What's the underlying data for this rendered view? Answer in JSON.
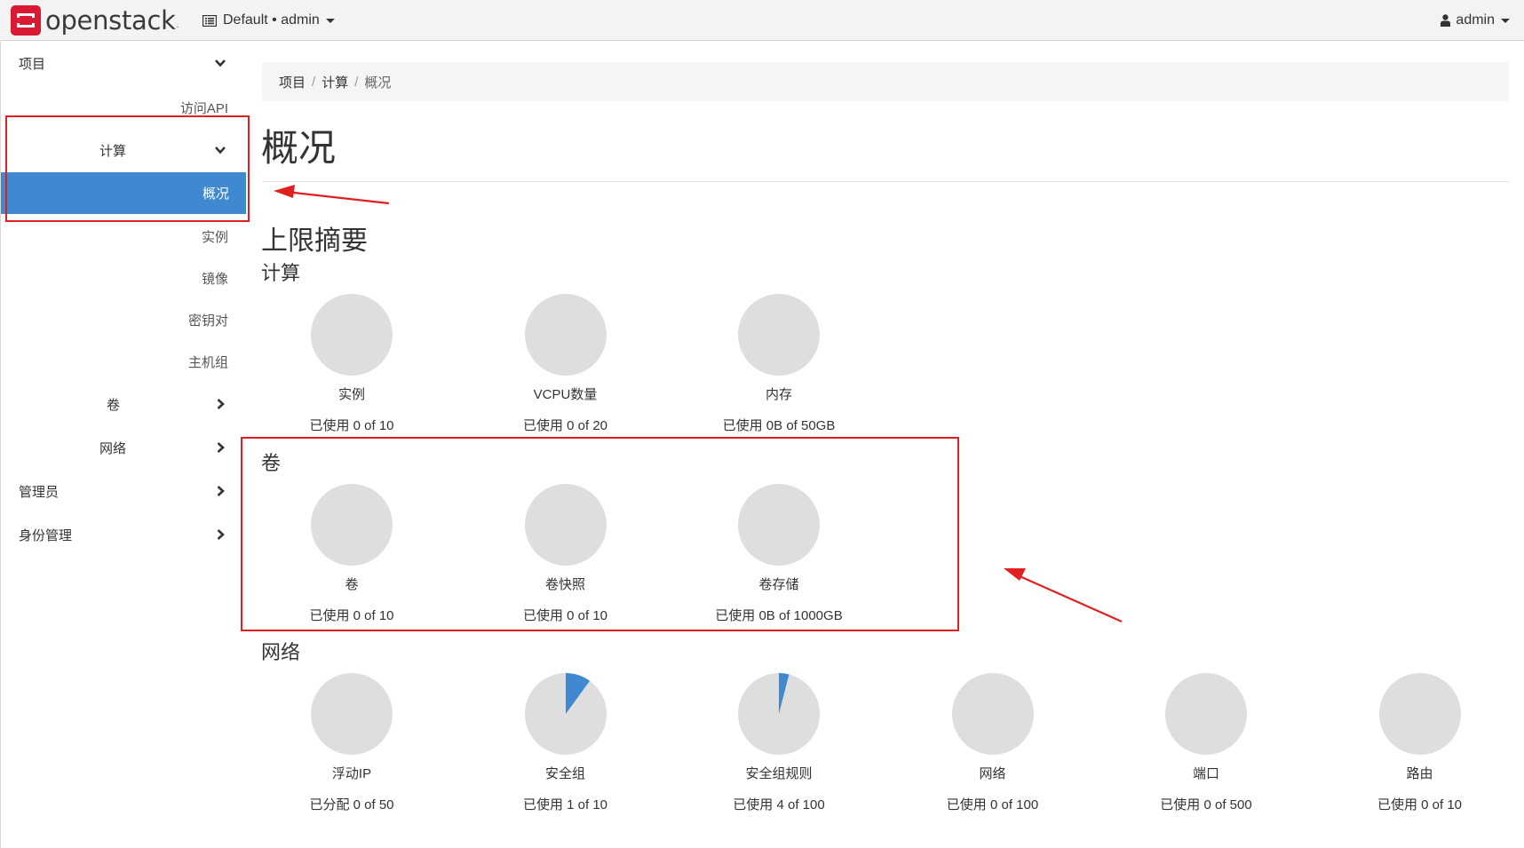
{
  "navbar": {
    "logo_text": "openstack",
    "logo_mark": ".",
    "context": "Default • admin",
    "user": "admin"
  },
  "sidebar": {
    "project": "项目",
    "api_access": "访问API",
    "compute": "计算",
    "overview": "概况",
    "instances": "实例",
    "images": "镜像",
    "key_pairs": "密钥对",
    "server_groups": "主机组",
    "volumes": "卷",
    "network": "网络",
    "admin": "管理员",
    "identity": "身份管理"
  },
  "breadcrumb": {
    "project": "项目",
    "compute": "计算",
    "current": "概况",
    "sep": "/"
  },
  "page": {
    "title": "概况",
    "limit_summary": "上限摘要",
    "compute_heading": "计算",
    "volume_heading": "卷",
    "network_heading": "网络"
  },
  "quotas": {
    "compute": [
      {
        "label": "实例",
        "usage": "已使用 0 of 10",
        "used": 0,
        "limit": 10
      },
      {
        "label": "VCPU数量",
        "usage": "已使用 0 of 20",
        "used": 0,
        "limit": 20
      },
      {
        "label": "内存",
        "usage": "已使用 0B of 50GB",
        "used": 0,
        "limit": 50
      }
    ],
    "volume": [
      {
        "label": "卷",
        "usage": "已使用 0 of 10",
        "used": 0,
        "limit": 10
      },
      {
        "label": "卷快照",
        "usage": "已使用 0 of 10",
        "used": 0,
        "limit": 10
      },
      {
        "label": "卷存储",
        "usage": "已使用 0B of 1000GB",
        "used": 0,
        "limit": 1000
      }
    ],
    "network": [
      {
        "label": "浮动IP",
        "usage": "已分配 0 of 50",
        "used": 0,
        "limit": 50
      },
      {
        "label": "安全组",
        "usage": "已使用 1 of 10",
        "used": 1,
        "limit": 10
      },
      {
        "label": "安全组规则",
        "usage": "已使用 4 of 100",
        "used": 4,
        "limit": 100
      },
      {
        "label": "网络",
        "usage": "已使用 0 of 100",
        "used": 0,
        "limit": 100
      },
      {
        "label": "端口",
        "usage": "已使用 0 of 500",
        "used": 0,
        "limit": 500
      },
      {
        "label": "路由",
        "usage": "已使用 0 of 10",
        "used": 0,
        "limit": 10
      }
    ]
  },
  "colors": {
    "accent": "#3e89d0",
    "pie_empty": "#dedede",
    "annotation": "#e02020",
    "logo_red": "#da1a32"
  }
}
